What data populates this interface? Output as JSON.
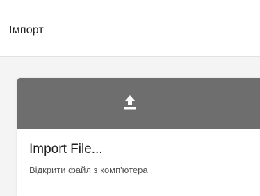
{
  "header": {
    "title": "Імпорт"
  },
  "import_card": {
    "icon": "upload-icon",
    "title": "Import File...",
    "subtitle": "Відкрити файл з комп'ютера"
  },
  "colors": {
    "banner": "#6e6e6e",
    "icon": "#ffffff"
  }
}
